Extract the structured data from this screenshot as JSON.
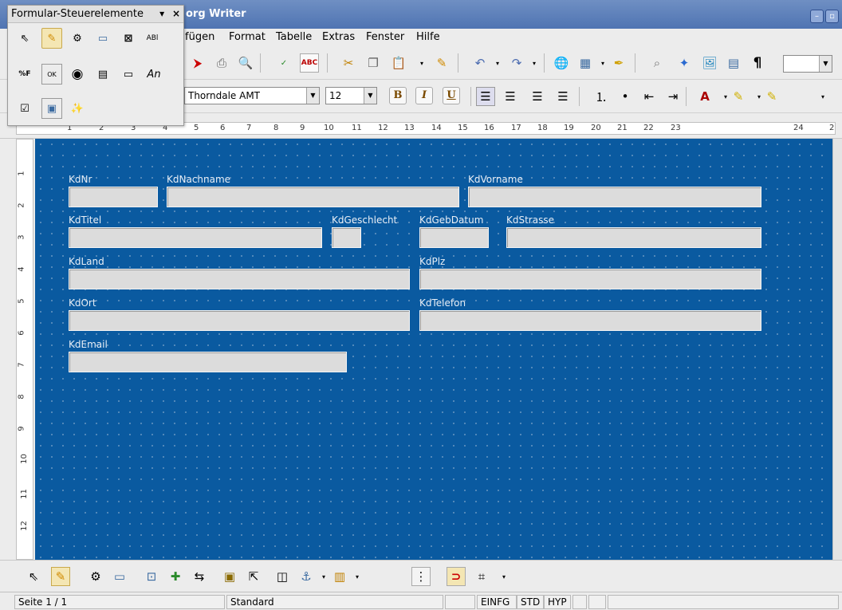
{
  "window": {
    "title": "org Writer",
    "minimize": "–",
    "maximize": "▫"
  },
  "menu": [
    "fügen",
    "Format",
    "Tabelle",
    "Extras",
    "Fenster",
    "Hilfe"
  ],
  "formatting": {
    "font": "Thorndale AMT",
    "size": "12",
    "bold": "B",
    "italic": "I",
    "underline": "U"
  },
  "ruler": {
    "h_numbers": [
      "1",
      "2",
      "3",
      "4",
      "5",
      "6",
      "7",
      "8",
      "9",
      "10",
      "11",
      "12",
      "13",
      "14",
      "15",
      "16",
      "17",
      "18",
      "19",
      "20",
      "21",
      "22",
      "23",
      "24",
      "2"
    ],
    "v_numbers": [
      "1",
      "2",
      "3",
      "4",
      "5",
      "6",
      "7",
      "8",
      "9",
      "10",
      "11",
      "12"
    ]
  },
  "form": {
    "fields": [
      {
        "label": "KdNr"
      },
      {
        "label": "KdNachname"
      },
      {
        "label": "KdVorname"
      },
      {
        "label": "KdTitel"
      },
      {
        "label": "KdGeschlecht"
      },
      {
        "label": "KdGebDatum"
      },
      {
        "label": "KdStrasse"
      },
      {
        "label": "KdLand"
      },
      {
        "label": "KdPlz"
      },
      {
        "label": "KdOrt"
      },
      {
        "label": "KdTelefon"
      },
      {
        "label": "KdEmail"
      }
    ]
  },
  "palette": {
    "title": "Formular-Steuerelemente",
    "menu_arrow": "▾",
    "close": "×",
    "text_label": "An",
    "abl": "ABl",
    "pct": "%F",
    "ok": "OK"
  },
  "status": {
    "page": "Seite 1 / 1",
    "style": "Standard",
    "insert": "EINFG",
    "std": "STD",
    "hyp": "HYP"
  },
  "colors": {
    "form_background": "#0a5aa0",
    "title_bar": "#4f74b2",
    "field": "#dcdcdc"
  }
}
